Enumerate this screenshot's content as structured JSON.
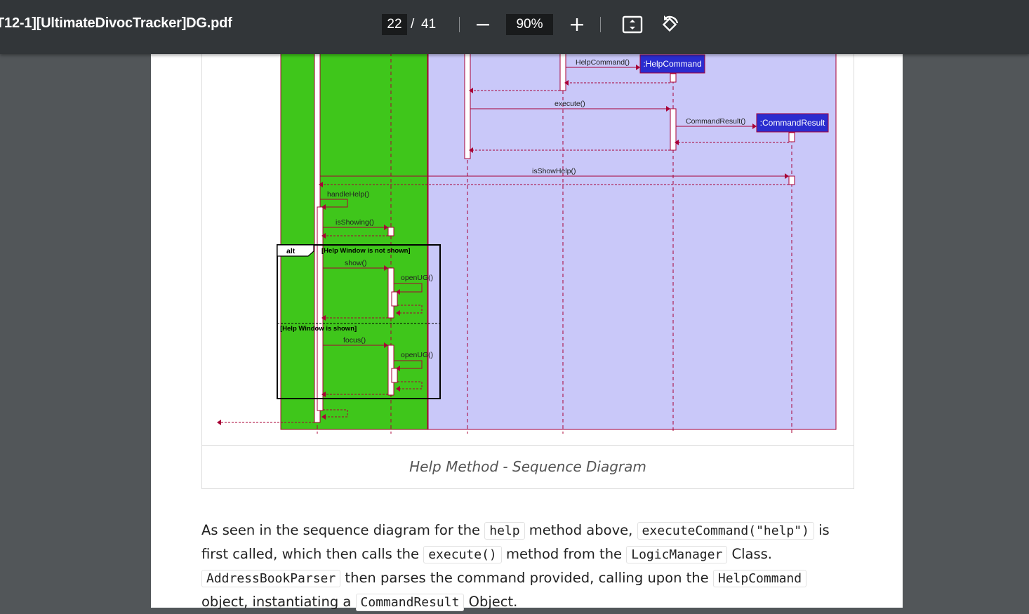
{
  "toolbar": {
    "title": "T12-1][UltimateDivocTracker]DG.pdf",
    "current_page": "22",
    "page_separator": "/",
    "total_pages": "41",
    "zoom": "90%",
    "icons": [
      "zoom-out-icon",
      "zoom-in-icon",
      "fit-page-icon",
      "rotate-icon"
    ]
  },
  "diagram": {
    "participants": [
      ":HelpCommand",
      ":CommandResult"
    ],
    "messages": [
      "HelpCommand()",
      "execute()",
      "CommandResult()",
      "isShowHelp()",
      "handleHelp()",
      "isShowing()",
      "show()",
      "openUG()",
      "focus()",
      "openUG()"
    ],
    "alt_label": "alt",
    "guard_1": "[Help Window is not shown]",
    "guard_2": "[Help Window is shown]"
  },
  "caption": "Help Method - Sequence Diagram",
  "paragraph": {
    "t1": "As seen in the sequence diagram for the ",
    "c1": "help",
    "t2": " method above, ",
    "c2": "executeCommand(\"help\")",
    "t3": " is first called, which then calls the ",
    "c3": "execute()",
    "t4": " method from the ",
    "c4": "LogicManager",
    "t5": " Class. ",
    "c5": "AddressBookParser",
    "t6": " then parses the command provided, calling upon the ",
    "c6": "HelpCommand",
    "t7": " object, instantiating a ",
    "c7": "CommandResult",
    "t8": " Object."
  },
  "colors": {
    "toolbar_bg": "#323639",
    "viewer_bg": "#525659",
    "green_box": "#3fc61b",
    "lavender_box": "#c9c8f9",
    "arrow": "#a80036",
    "participant_box": "#2a2ccf"
  }
}
